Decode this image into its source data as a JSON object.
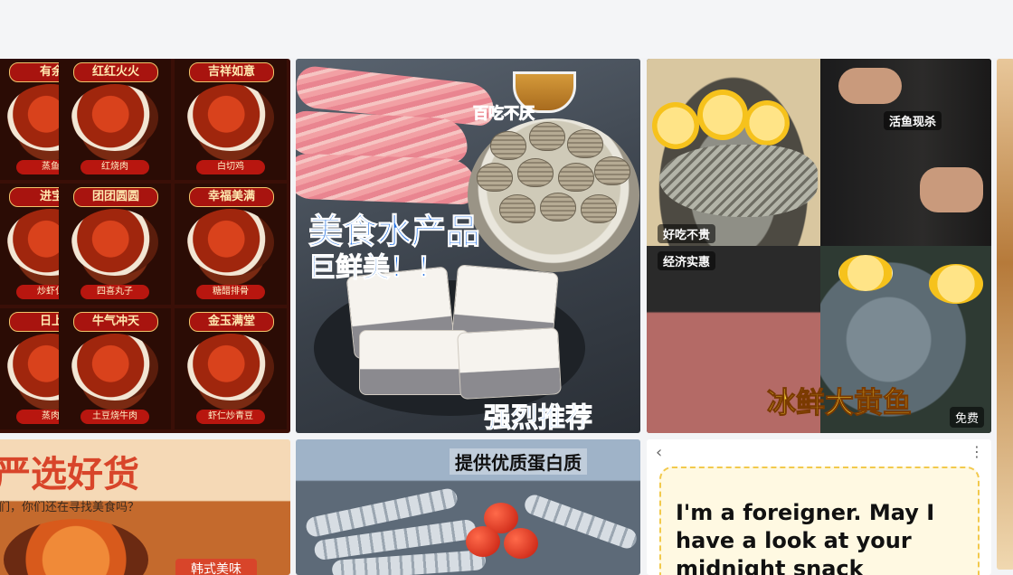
{
  "card1": {
    "cells": [
      {
        "title": "有余",
        "label": "蒸鱼"
      },
      {
        "title": "红红火火",
        "label": "红烧肉"
      },
      {
        "title": "吉祥如意",
        "label": "白切鸡"
      },
      {
        "title": "进宝",
        "label": "炒虾仁"
      },
      {
        "title": "团团圆圆",
        "label": "四喜丸子"
      },
      {
        "title": "幸福美满",
        "label": "糖醋排骨"
      },
      {
        "title": "日上",
        "label": "蒸肉"
      },
      {
        "title": "牛气冲天",
        "label": "土豆烧牛肉"
      },
      {
        "title": "金玉满堂",
        "label": "虾仁炒青豆"
      }
    ]
  },
  "card2": {
    "tag_top": "百吃不厌",
    "headline": "美食水产品",
    "subline": "巨鲜美！！",
    "bottom": "强烈推荐"
  },
  "card3": {
    "tag_live": "活鱼现杀",
    "tag_tasty": "好吃不贵",
    "tag_value": "经济实惠",
    "banner": "冰鲜大黄鱼",
    "free": "免费"
  },
  "card4": {
    "title": "严选好货",
    "subtitle": "们，你们还在寻找美食吗？",
    "tag": "韩式美味"
  },
  "card5": {
    "title": "提供优质蛋白质"
  },
  "card6": {
    "back_glyph": "‹",
    "more_glyph": "⋮",
    "text": "I'm a foreigner. May I have a look at your midnight snack"
  }
}
